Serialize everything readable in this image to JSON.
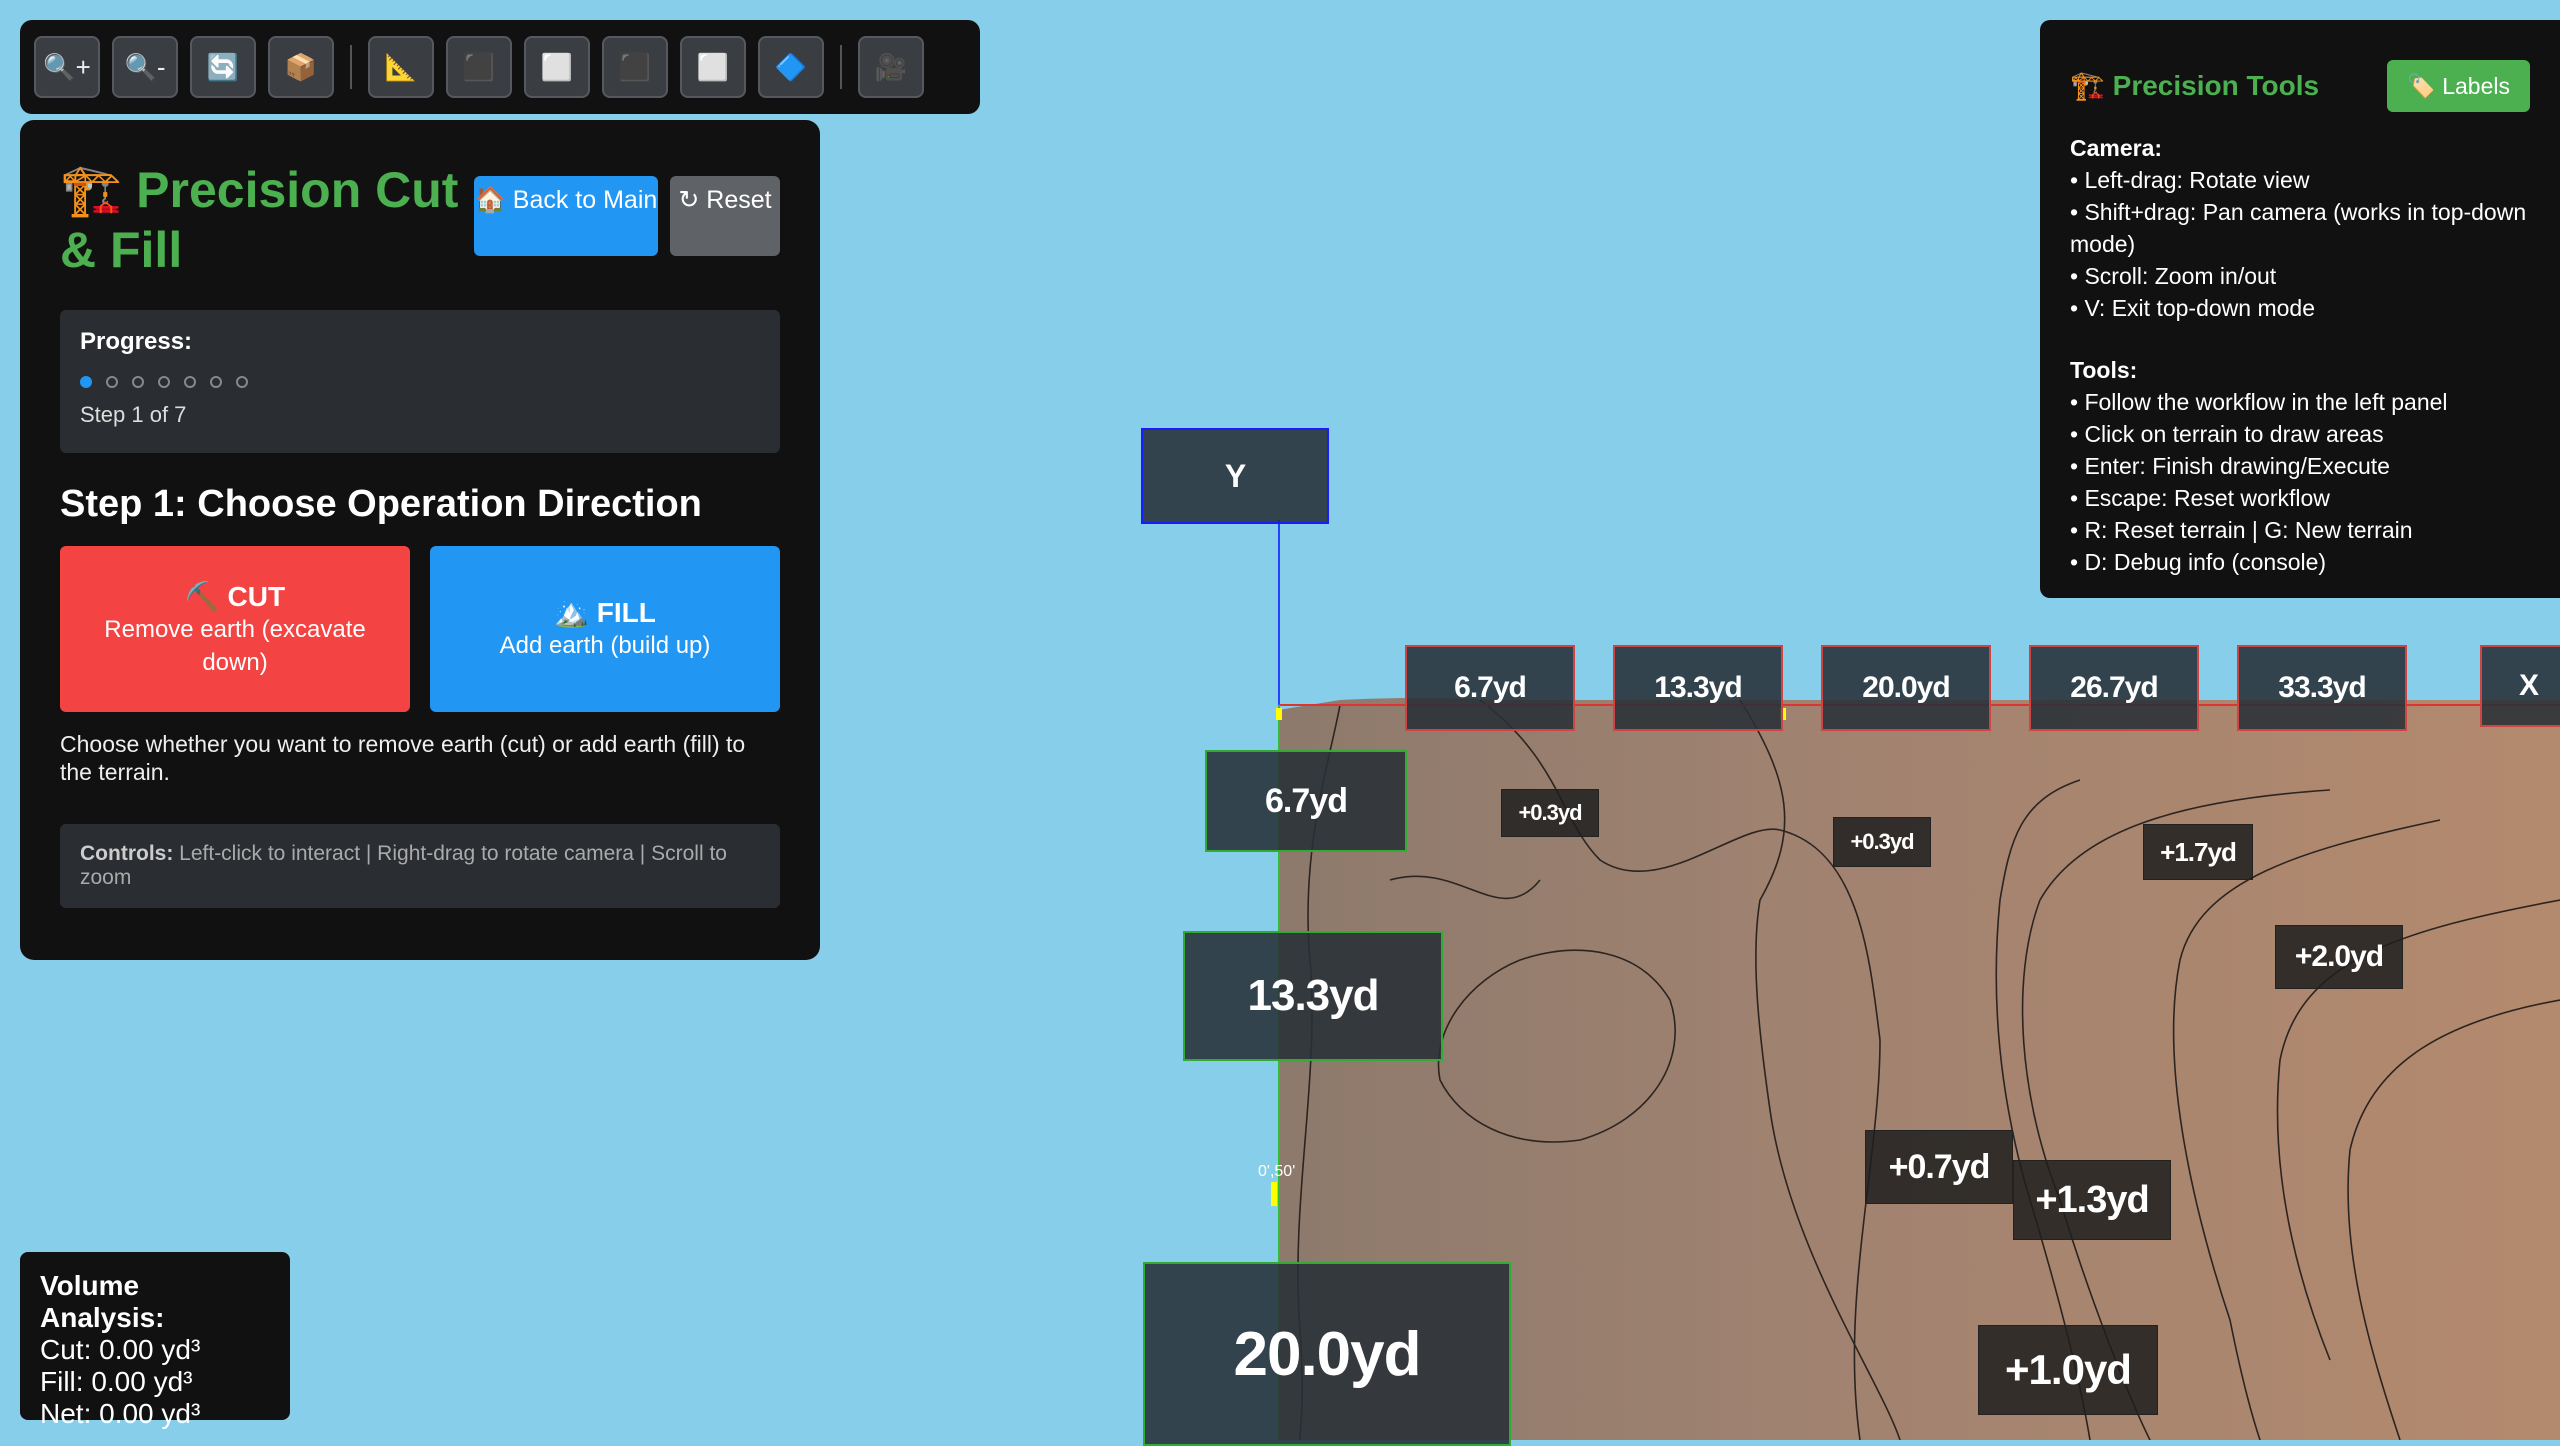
{
  "toolbar": {
    "buttons": [
      {
        "name": "zoom-in-button",
        "icon": "🔍+"
      },
      {
        "name": "zoom-out-button",
        "icon": "🔍-"
      },
      {
        "name": "refresh-button",
        "icon": "🔄"
      },
      {
        "name": "box-button",
        "icon": "📦"
      },
      {
        "name": "measure-button",
        "icon": "📐"
      },
      {
        "name": "dark-square-button-1",
        "icon": "⬛"
      },
      {
        "name": "white-square-button-1",
        "icon": "⬜"
      },
      {
        "name": "dark-square-button-2",
        "icon": "⬛"
      },
      {
        "name": "white-square-button-2",
        "icon": "⬜"
      },
      {
        "name": "blue-diamond-button",
        "icon": "🔷"
      },
      {
        "name": "camera-button",
        "icon": "🎥"
      }
    ]
  },
  "left_panel": {
    "title": "🏗️ Precision Cut & Fill",
    "back_button": "🏠 Back to Main",
    "reset_button": "↻ Reset",
    "progress_label": "Progress:",
    "progress": {
      "current": 1,
      "total": 7
    },
    "step_text": "Step 1 of 7",
    "step_heading": "Step 1: Choose Operation Direction",
    "cut": {
      "title": "⛏️ CUT",
      "desc": "Remove earth (excavate down)"
    },
    "fill": {
      "title": "🏔️ FILL",
      "desc": "Add earth (build up)"
    },
    "description": "Choose whether you want to remove earth (cut) or add earth (fill) to the terrain.",
    "controls_label": "Controls:",
    "controls_text": " Left-click to interact | Right-drag to rotate camera | Scroll to zoom"
  },
  "help_panel": {
    "title": "🏗️ Precision Tools",
    "labels_button": "🏷️ Labels",
    "camera_title": "Camera:",
    "camera_items": [
      "• Left-drag: Rotate view",
      "• Shift+drag: Pan camera (works in top-down mode)",
      "• Scroll: Zoom in/out",
      "• V: Exit top-down mode"
    ],
    "tools_title": "Tools:",
    "tools_items": [
      "• Follow the workflow in the left panel",
      "• Click on terrain to draw areas",
      "• Enter: Finish drawing/Execute",
      "• Escape: Reset workflow",
      "• R: Reset terrain | G: New terrain",
      "• D: Debug info (console)"
    ]
  },
  "volume": {
    "title": "Volume Analysis:",
    "cut": "Cut: 0.00 yd³",
    "fill": "Fill: 0.00 yd³",
    "net": "Net: 0.00 yd³"
  },
  "scene": {
    "y_axis_label": "Y",
    "x_axis_label": "X",
    "top_labels": [
      "6.7yd",
      "13.3yd",
      "20.0yd",
      "26.7yd",
      "33.3yd"
    ],
    "left_labels": [
      "6.7yd",
      "13.3yd",
      "20.0yd"
    ],
    "contour_labels": [
      "+0.3yd",
      "+0.3yd",
      "+1.7yd",
      "+2.0yd",
      "+0.7yd",
      "+1.3yd",
      "+1.0yd"
    ],
    "marker_label": "0',50'",
    "colors": {
      "sky": "#87CEEB",
      "terrain": "#a0826d",
      "accent": "#4caf50"
    }
  }
}
